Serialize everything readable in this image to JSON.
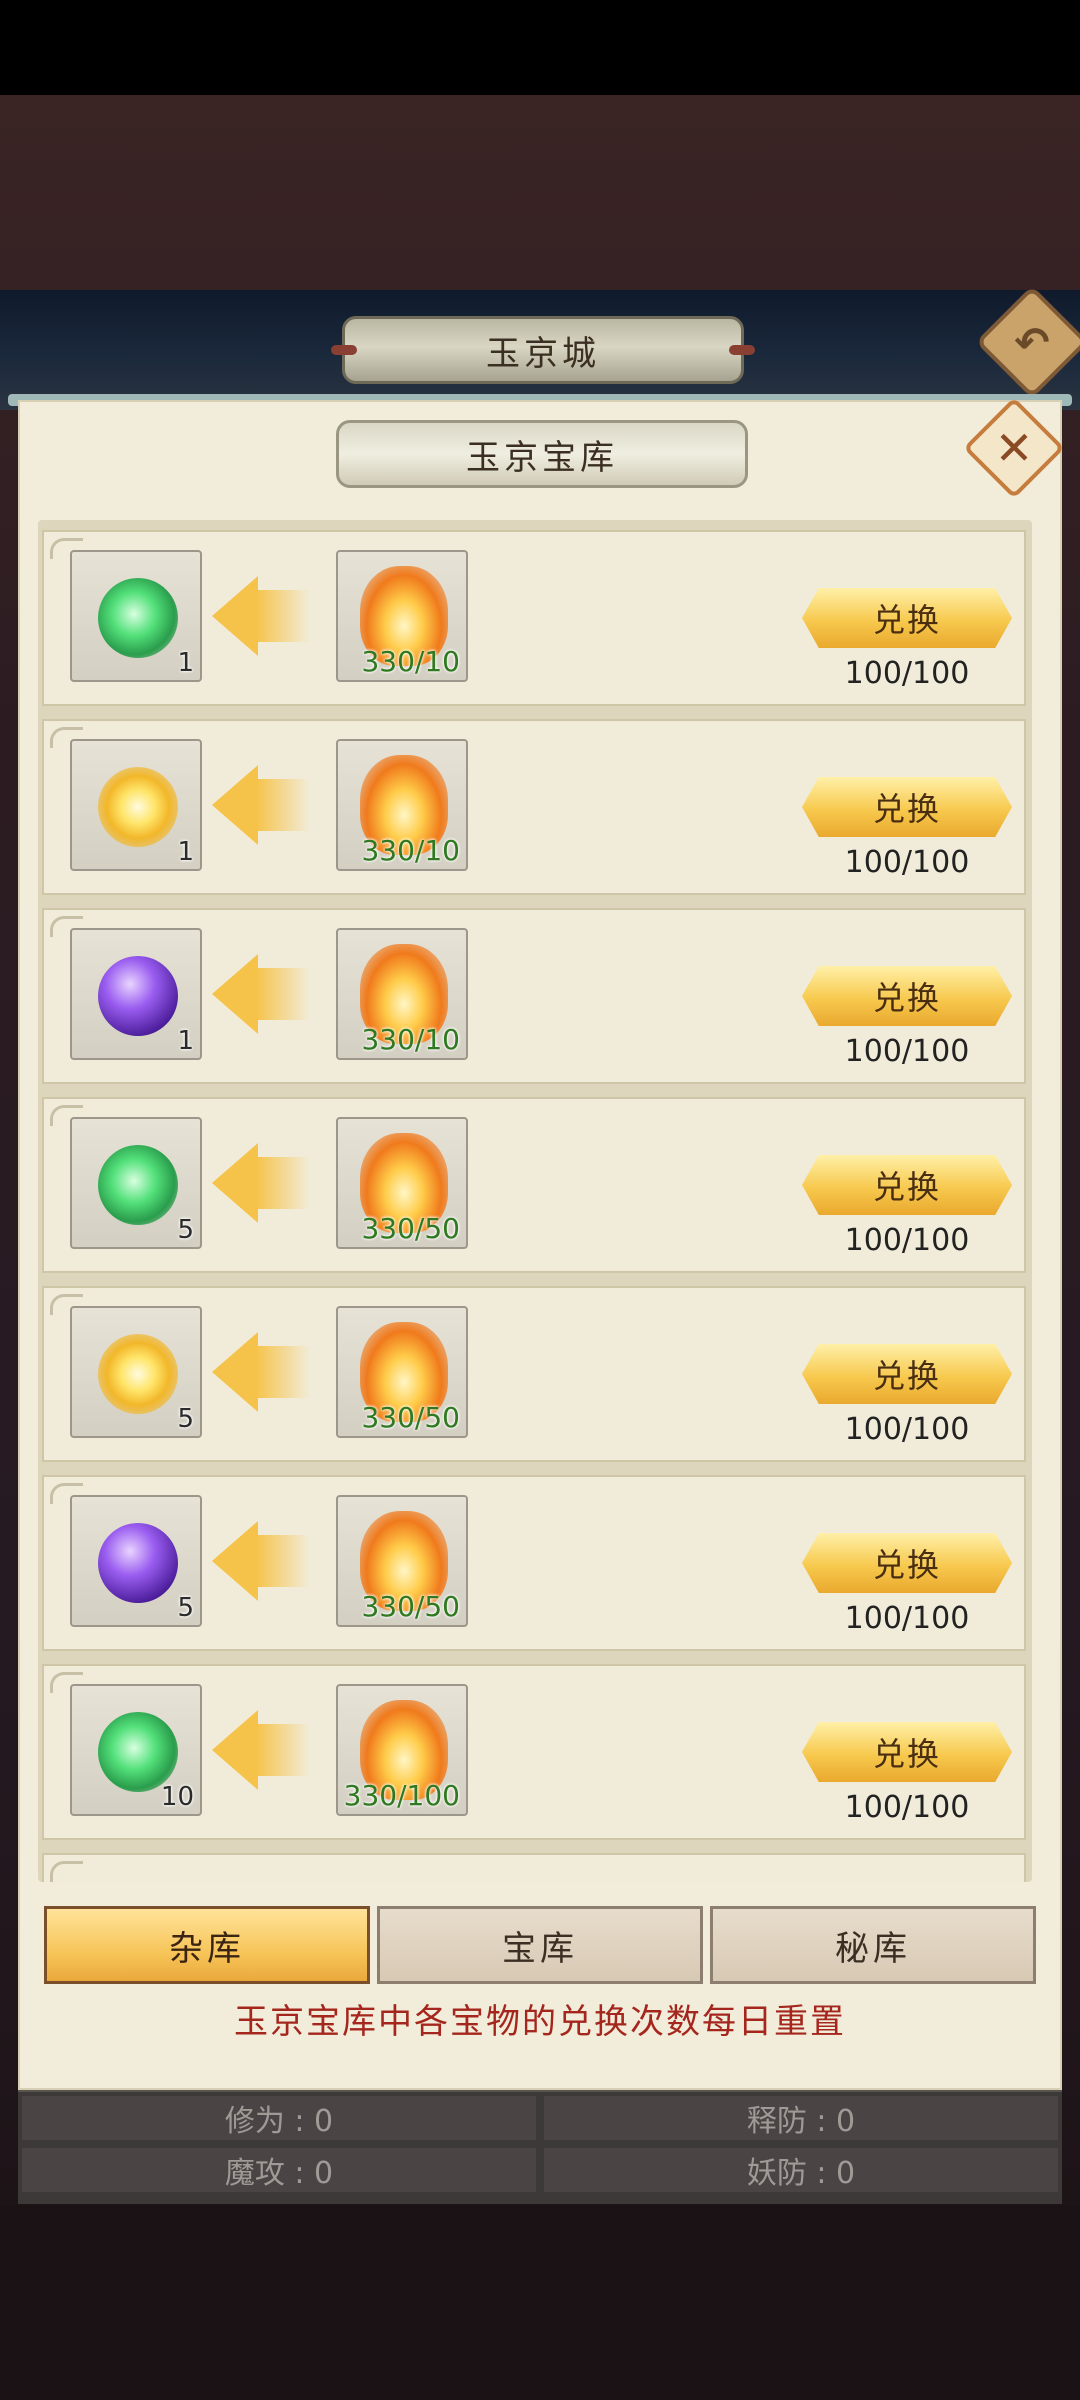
{
  "city_title": "玉京城",
  "panel_title": "玉京宝库",
  "back_icon": "back-arrow-icon",
  "close_icon": "close-x-icon",
  "rows": [
    {
      "reward_icon": "green-spirit-orb-icon",
      "reward_qty": "1",
      "cost_icon": "flame-icon",
      "cost": "330/10",
      "button": "兑换",
      "limit": "100/100"
    },
    {
      "reward_icon": "golden-spark-icon",
      "reward_qty": "1",
      "cost_icon": "flame-icon",
      "cost": "330/10",
      "button": "兑换",
      "limit": "100/100"
    },
    {
      "reward_icon": "purple-orb-icon",
      "reward_qty": "1",
      "cost_icon": "flame-icon",
      "cost": "330/10",
      "button": "兑换",
      "limit": "100/100"
    },
    {
      "reward_icon": "green-spirit-orb-icon",
      "reward_qty": "5",
      "cost_icon": "flame-icon",
      "cost": "330/50",
      "button": "兑换",
      "limit": "100/100"
    },
    {
      "reward_icon": "golden-spark-icon",
      "reward_qty": "5",
      "cost_icon": "flame-icon",
      "cost": "330/50",
      "button": "兑换",
      "limit": "100/100"
    },
    {
      "reward_icon": "purple-orb-icon",
      "reward_qty": "5",
      "cost_icon": "flame-icon",
      "cost": "330/50",
      "button": "兑换",
      "limit": "100/100"
    },
    {
      "reward_icon": "green-spirit-orb-icon",
      "reward_qty": "10",
      "cost_icon": "flame-icon",
      "cost": "330/100",
      "button": "兑换",
      "limit": "100/100"
    }
  ],
  "tabs": [
    {
      "label": "杂库",
      "active": true
    },
    {
      "label": "宝库",
      "active": false
    },
    {
      "label": "秘库",
      "active": false
    }
  ],
  "notice": "玉京宝库中各宝物的兑换次数每日重置",
  "stats": {
    "cultivation": "修为 : 0",
    "release_defense": "释防 : 0",
    "magic_attack": "魔攻 : 0",
    "demon_defense": "妖防 : 0"
  },
  "colors": {
    "panel_bg": "#f2eddb",
    "button_gold": "#f7c94e",
    "cost_green": "#2f7a20",
    "notice_red": "#a4261c"
  }
}
